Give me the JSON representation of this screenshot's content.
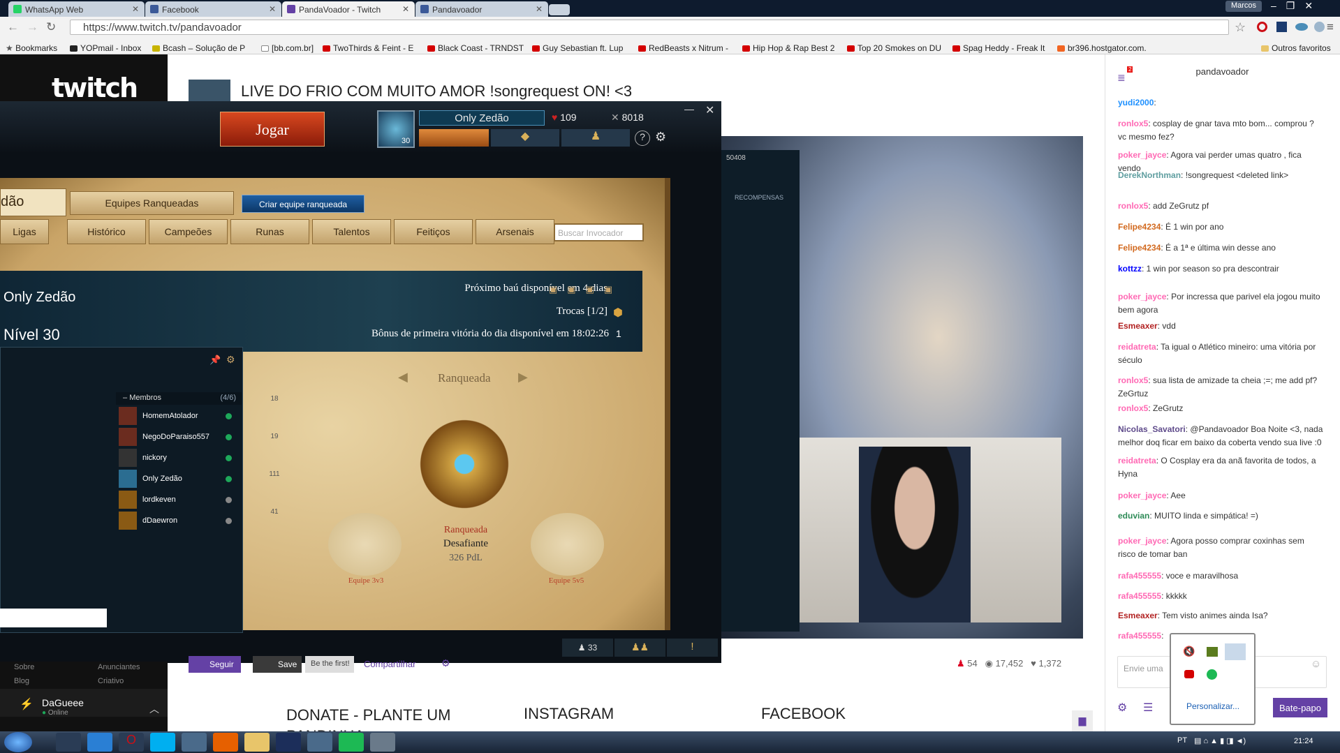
{
  "browser": {
    "tabs": [
      {
        "label": "WhatsApp Web",
        "color": "#25d366",
        "active": false
      },
      {
        "label": "Facebook",
        "color": "#3b5998",
        "active": false
      },
      {
        "label": "PandaVoador - Twitch",
        "color": "#6441a5",
        "active": true
      },
      {
        "label": "Pandavoador",
        "color": "#3b5998",
        "active": false
      }
    ],
    "user": "Marcos",
    "url": "https://www.twitch.tv/pandavoador",
    "bookmarks": [
      "Bookmarks",
      "YOPmail - Inbox",
      "Bcash – Solução de P",
      "[bb.com.br]",
      "TwoThirds & Feint - E",
      "Black Coast - TRNDST",
      "Guy Sebastian ft. Lup",
      "RedBeasts x Nitrum -",
      "Hip Hop & Rap Best 2",
      "Top 20 Smokes on DU",
      "Spag Heddy - Freak It",
      "br396.hostgator.com.",
      "Outros favoritos"
    ]
  },
  "stream": {
    "title": "LIVE DO FRIO COM MUITO AMOR !songrequest ON! <3",
    "follow_label": "Seguir",
    "save_label": "Save",
    "first_label": "Be the first!",
    "share_label": "Compartilhar",
    "stats": {
      "hosts": "54",
      "viewers": "17,452",
      "followers": "1,372"
    },
    "panels": [
      "DONATE - PLANTE UM PANDINHA",
      "INSTAGRAM",
      "FACEBOOK"
    ]
  },
  "sidebar": {
    "links": [
      "Sobre",
      "Anunciantes",
      "Blog",
      "Criativo"
    ],
    "user_name": "DaGueee",
    "user_status": "Online"
  },
  "game": {
    "play_label": "Jogar",
    "summoner_name": "Only Zedão",
    "level_badge": "30",
    "rp": "109",
    "ip": "8018",
    "second_window_value": "50408",
    "rewards_label": "RECOMPENSAS",
    "page_title_fragment": "dão",
    "top_tabs": [
      "Equipes Ranqueadas",
      "Criar equipe ranqueada"
    ],
    "tabs": [
      "Ligas",
      "Histórico",
      "Campeões",
      "Runas",
      "Talentos",
      "Feitiços",
      "Arsenais"
    ],
    "search_placeholder": "Buscar Invocador",
    "next_chest": "Próximo baú disponível em 4 dias",
    "trades": "Trocas [1/2]",
    "first_win": "Bônus de primeira vitória do dia disponível em 18:02:26",
    "profile_name": "Only Zedão",
    "profile_level": "Nível 30",
    "members_label": "Membros",
    "members_count": "(4/6)",
    "members": [
      "HomemAtolador",
      "NegoDoParaiso557",
      "nickory",
      "Only Zedão",
      "lordkeven",
      "dDaewron"
    ],
    "side_stats": [
      "18",
      "19",
      "111",
      "41"
    ],
    "rank_nav": "Ranqueada",
    "rank_queue": "Ranqueada",
    "rank_tier": "Desafiante",
    "rank_lp": "326 PdL",
    "team3": "Equipe 3v3",
    "team5": "Equipe 5v5",
    "bottom_friends": "33"
  },
  "chat": {
    "channel": "pandavoador",
    "notif_count": "2",
    "messages": [
      {
        "user": "yudi2000",
        "color": "#1e90ff",
        "text": ""
      },
      {
        "user": "ronlox5",
        "color": "#ff69b4",
        "text": "cosplay de gnar tava mto bom... comprou ? vc mesmo fez?"
      },
      {
        "user": "poker_jayce",
        "color": "#ff69b4",
        "text": "Agora vai perder umas quatro , fica vendo"
      },
      {
        "user": "DerekNorthman",
        "color": "#5f9ea0",
        "text": "!songrequest <deleted link>"
      },
      {
        "user": "ronlox5",
        "color": "#ff69b4",
        "text": "add ZeGrutz pf"
      },
      {
        "user": "Felipe4234",
        "color": "#d2691e",
        "text": "É 1 win por ano"
      },
      {
        "user": "Felipe4234",
        "color": "#d2691e",
        "text": "É a 1ª e última win desse ano"
      },
      {
        "user": "kottzz",
        "color": "#0000ff",
        "text": "1 win por season so pra descontrair"
      },
      {
        "user": "poker_jayce",
        "color": "#ff69b4",
        "text": "Por incressa que parivel ela jogou muito bem agora"
      },
      {
        "user": "Esmeaxer",
        "color": "#b22222",
        "text": "vdd"
      },
      {
        "user": "reidatreta",
        "color": "#ff69b4",
        "text": "Ta igual o Atlético mineiro: uma vitória por século"
      },
      {
        "user": "ronlox5",
        "color": "#ff69b4",
        "text": "sua lista de amizade ta cheia ;=; me add pf? ZeGrtuz"
      },
      {
        "user": "ronlox5",
        "color": "#ff69b4",
        "text": "ZeGrutz"
      },
      {
        "user": "Nicolas_Savatori",
        "color": "#5f4b8b",
        "text": "@Pandavoador Boa Noite <3, nada melhor doq ficar em baixo da coberta vendo sua live :0"
      },
      {
        "user": "reidatreta",
        "color": "#ff69b4",
        "text": "O Cosplay era da anã favorita de todos, a Hyna"
      },
      {
        "user": "poker_jayce",
        "color": "#ff69b4",
        "text": "Aee"
      },
      {
        "user": "eduvian",
        "color": "#2e8b57",
        "text": "MUITO linda e simpática! =)"
      },
      {
        "user": "poker_jayce",
        "color": "#ff69b4",
        "text": "Agora posso comprar coxinhas sem risco de tomar ban"
      },
      {
        "user": "rafa455555",
        "color": "#ff69b4",
        "text": "voce e maravilhosa"
      },
      {
        "user": "rafa455555",
        "color": "#ff69b4",
        "text": "kkkkk"
      },
      {
        "user": "Esmeaxer",
        "color": "#b22222",
        "text": "Tem visto animes ainda Isa?"
      },
      {
        "user": "rafa455555",
        "color": "#ff69b4",
        "text": ""
      }
    ],
    "input_placeholder": "Envie uma",
    "send_label": "Bate-papo",
    "tray_customize": "Personalizar..."
  },
  "taskbar": {
    "lang": "PT",
    "time": "21:24"
  }
}
